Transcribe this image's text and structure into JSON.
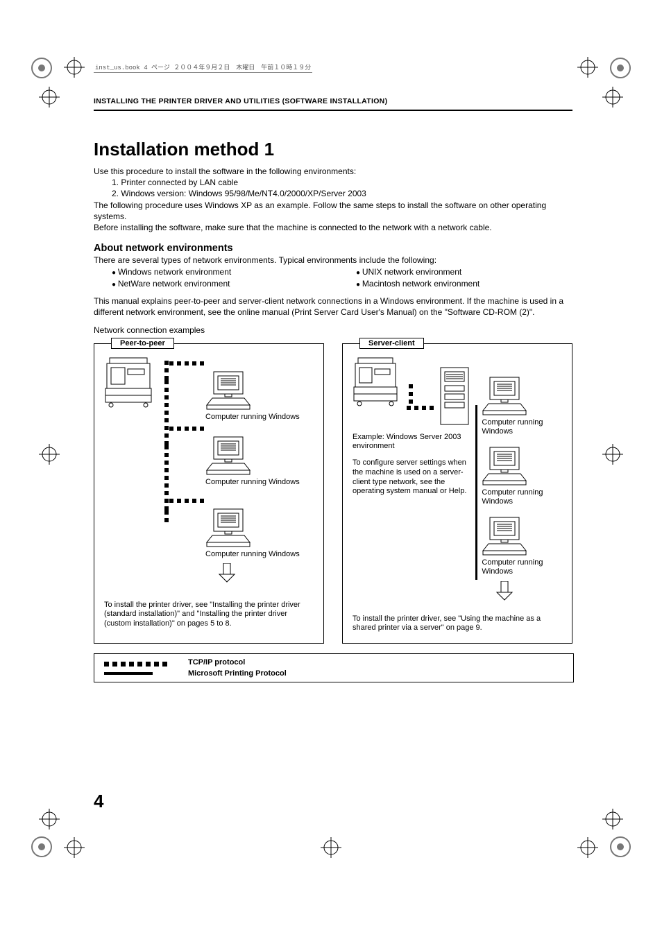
{
  "header_meta": "inst_us.book  4 ページ  ２００４年９月２日　木曜日　午前１０時１９分",
  "section_header": "INSTALLING THE PRINTER DRIVER AND UTILITIES (SOFTWARE INSTALLATION)",
  "h1": "Installation method 1",
  "intro": {
    "p1": "Use this procedure to install the software in the following environments:",
    "li1": "1. Printer connected by LAN cable",
    "li2": "2. Windows version: Windows 95/98/Me/NT4.0/2000/XP/Server 2003",
    "p2": "The following procedure uses Windows XP as an example. Follow the same steps to install the software on other operating systems.",
    "p3": "Before installing the software, make sure that the machine is connected to the network with a network cable."
  },
  "h2": "About network environments",
  "env_intro": "There are several types of network environments. Typical environments include the following:",
  "env_bullets": {
    "a": "Windows network environment",
    "b": "NetWare network environment",
    "c": "UNIX network environment",
    "d": "Macintosh network environment"
  },
  "env_para": "This manual explains peer-to-peer and server-client network connections in a Windows environment. If the machine is used in a different network environment, see the online manual (Print Server Card User's Manual) on the \"Software CD-ROM (2)\".",
  "examples_title": "Network connection examples",
  "p2p": {
    "label": "Peer-to-peer",
    "caption": "Computer running Windows",
    "note": "To install the printer driver, see \"Installing the printer driver (standard installation)\" and \"Installing the printer driver (custom installation)\" on pages 5 to 8."
  },
  "sc": {
    "label": "Server-client",
    "server_ex": "Example: Windows Server 2003 environment",
    "server_help": "To configure server settings when the machine is used on a server-client type network, see the operating system manual or Help.",
    "caption": "Computer running Windows",
    "note": "To install the printer driver, see \"Using the machine as a shared printer via a server\" on page 9."
  },
  "legend": {
    "tcpip": "TCP/IP protocol",
    "msprint": "Microsoft Printing Protocol"
  },
  "page_number": "4"
}
